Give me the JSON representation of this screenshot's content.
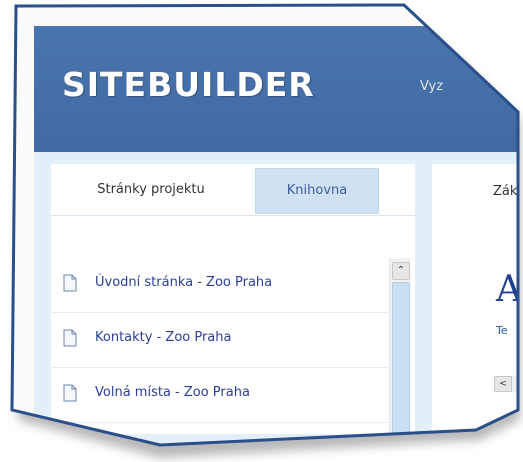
{
  "app": {
    "logo_text": "SITEBUILDER",
    "menu_first_item": "Vyz"
  },
  "left_panel": {
    "tabs": [
      {
        "label": "Stránky projektu",
        "active": true
      },
      {
        "label": "Knihovna",
        "active": false
      }
    ],
    "pages": [
      {
        "label": "Úvodní stránka - Zoo Praha"
      },
      {
        "label": "Kontakty - Zoo Praha"
      },
      {
        "label": "Volná místa - Zoo Praha"
      }
    ],
    "scroll_up_glyph": "⌃"
  },
  "right_panel": {
    "tab_label_partial": "Zák",
    "big_letter": "A",
    "small_text": "Te",
    "scroll_left_glyph": "<"
  },
  "colors": {
    "header": "#4a74ad",
    "link": "#2c3f98",
    "tab_inactive_bg": "#cfe2f3"
  }
}
